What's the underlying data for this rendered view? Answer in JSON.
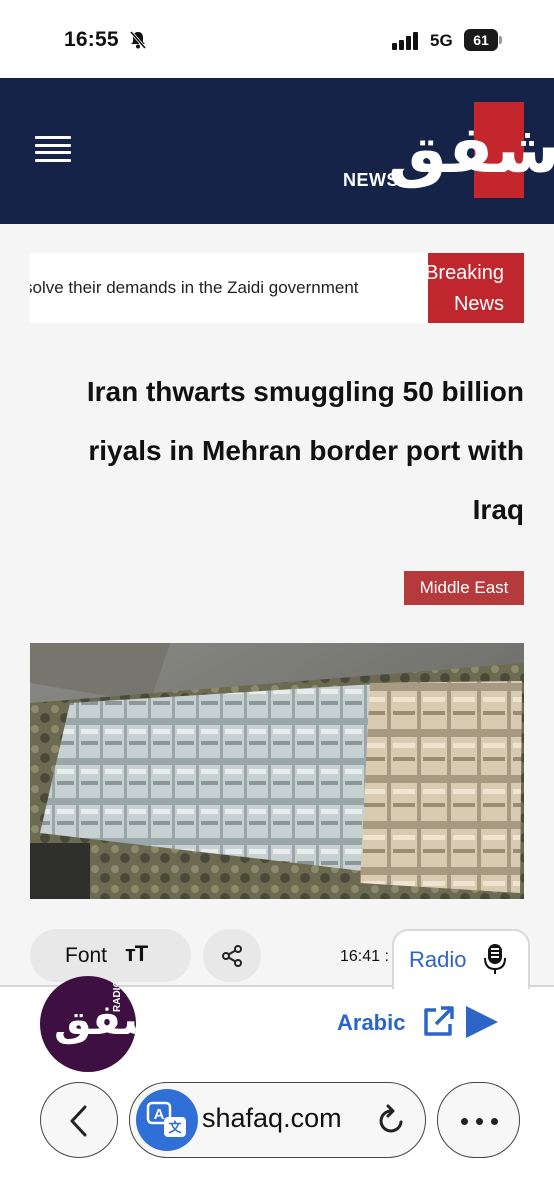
{
  "status": {
    "time": "16:55",
    "network": "5G",
    "battery": "61"
  },
  "header": {
    "logo_arabic": "شفق",
    "logo_news": "NEWS"
  },
  "ticker": {
    "text": "solve their demands in the Zaidi government",
    "label": "Breaking News"
  },
  "article": {
    "headline": "Iran thwarts smuggling 50 billion riyals in Mehran border port with Iraq",
    "category": "Middle East",
    "time": "16:41 :"
  },
  "toolbar": {
    "font_label": "Font",
    "font_icon": "тT"
  },
  "radio": {
    "tab_label": "Radio",
    "logo_arabic": "شفق",
    "logo_word": "RADIO",
    "language_link": "Arabic"
  },
  "browser": {
    "url": "shafaq.com"
  },
  "colors": {
    "header_bg": "#142347",
    "brand_red": "#c0262d",
    "link_blue": "#2c64c8"
  }
}
